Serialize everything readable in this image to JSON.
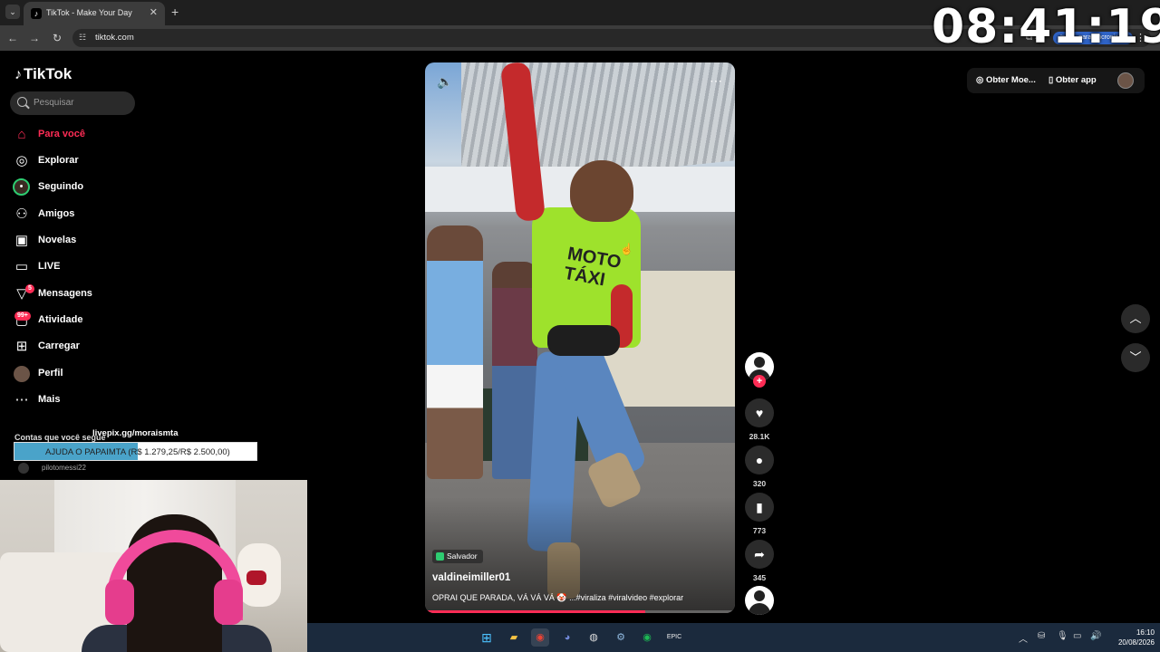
{
  "browser": {
    "tab_title": "TikTok - Make Your Day",
    "url": "tiktok.com",
    "profile_pill": "Inici... para sincronizar"
  },
  "stream_overlay": {
    "clock": "08:41:19",
    "livepix_url": "livepix.gg/moraismta",
    "donation_goal_text": "AJUDA O PAPAIMTA (R$ 1.279,25/R$ 2.500,00)",
    "donation_progress": 0.51
  },
  "sidebar": {
    "logo": "TikTok",
    "search_placeholder": "Pesquisar",
    "items": [
      {
        "label": "Para você",
        "icon": "home-icon"
      },
      {
        "label": "Explorar",
        "icon": "compass-icon"
      },
      {
        "label": "Seguindo",
        "icon": "following-icon"
      },
      {
        "label": "Amigos",
        "icon": "friends-icon"
      },
      {
        "label": "Novelas",
        "icon": "novelas-icon"
      },
      {
        "label": "LIVE",
        "icon": "live-icon"
      },
      {
        "label": "Mensagens",
        "icon": "send-icon",
        "badge": "5"
      },
      {
        "label": "Atividade",
        "icon": "activity-icon",
        "badge": "99+"
      },
      {
        "label": "Carregar",
        "icon": "upload-icon"
      },
      {
        "label": "Perfil",
        "icon": "profile-icon"
      },
      {
        "label": "Mais",
        "icon": "more-icon"
      }
    ],
    "following_title": "Contas que você segue",
    "followed_user": "pilotomessi22"
  },
  "video": {
    "location": "Salvador",
    "username": "valdineimiller01",
    "caption": "OPRAI QUE PARADA, VÁ VÁ VÁ 🤡 ...#viraliza #viralvideo #explorar",
    "shirt_text_1": "MOTO",
    "shirt_text_2": "TÁXI",
    "progress": 0.71
  },
  "actions": {
    "likes": "28.1K",
    "comments": "320",
    "saves": "773",
    "shares": "345"
  },
  "top_right": {
    "coins_label": "Obter Moe...",
    "app_label": "Obter app"
  },
  "taskbar": {
    "time": "16:10",
    "date": "20/08/2026"
  }
}
